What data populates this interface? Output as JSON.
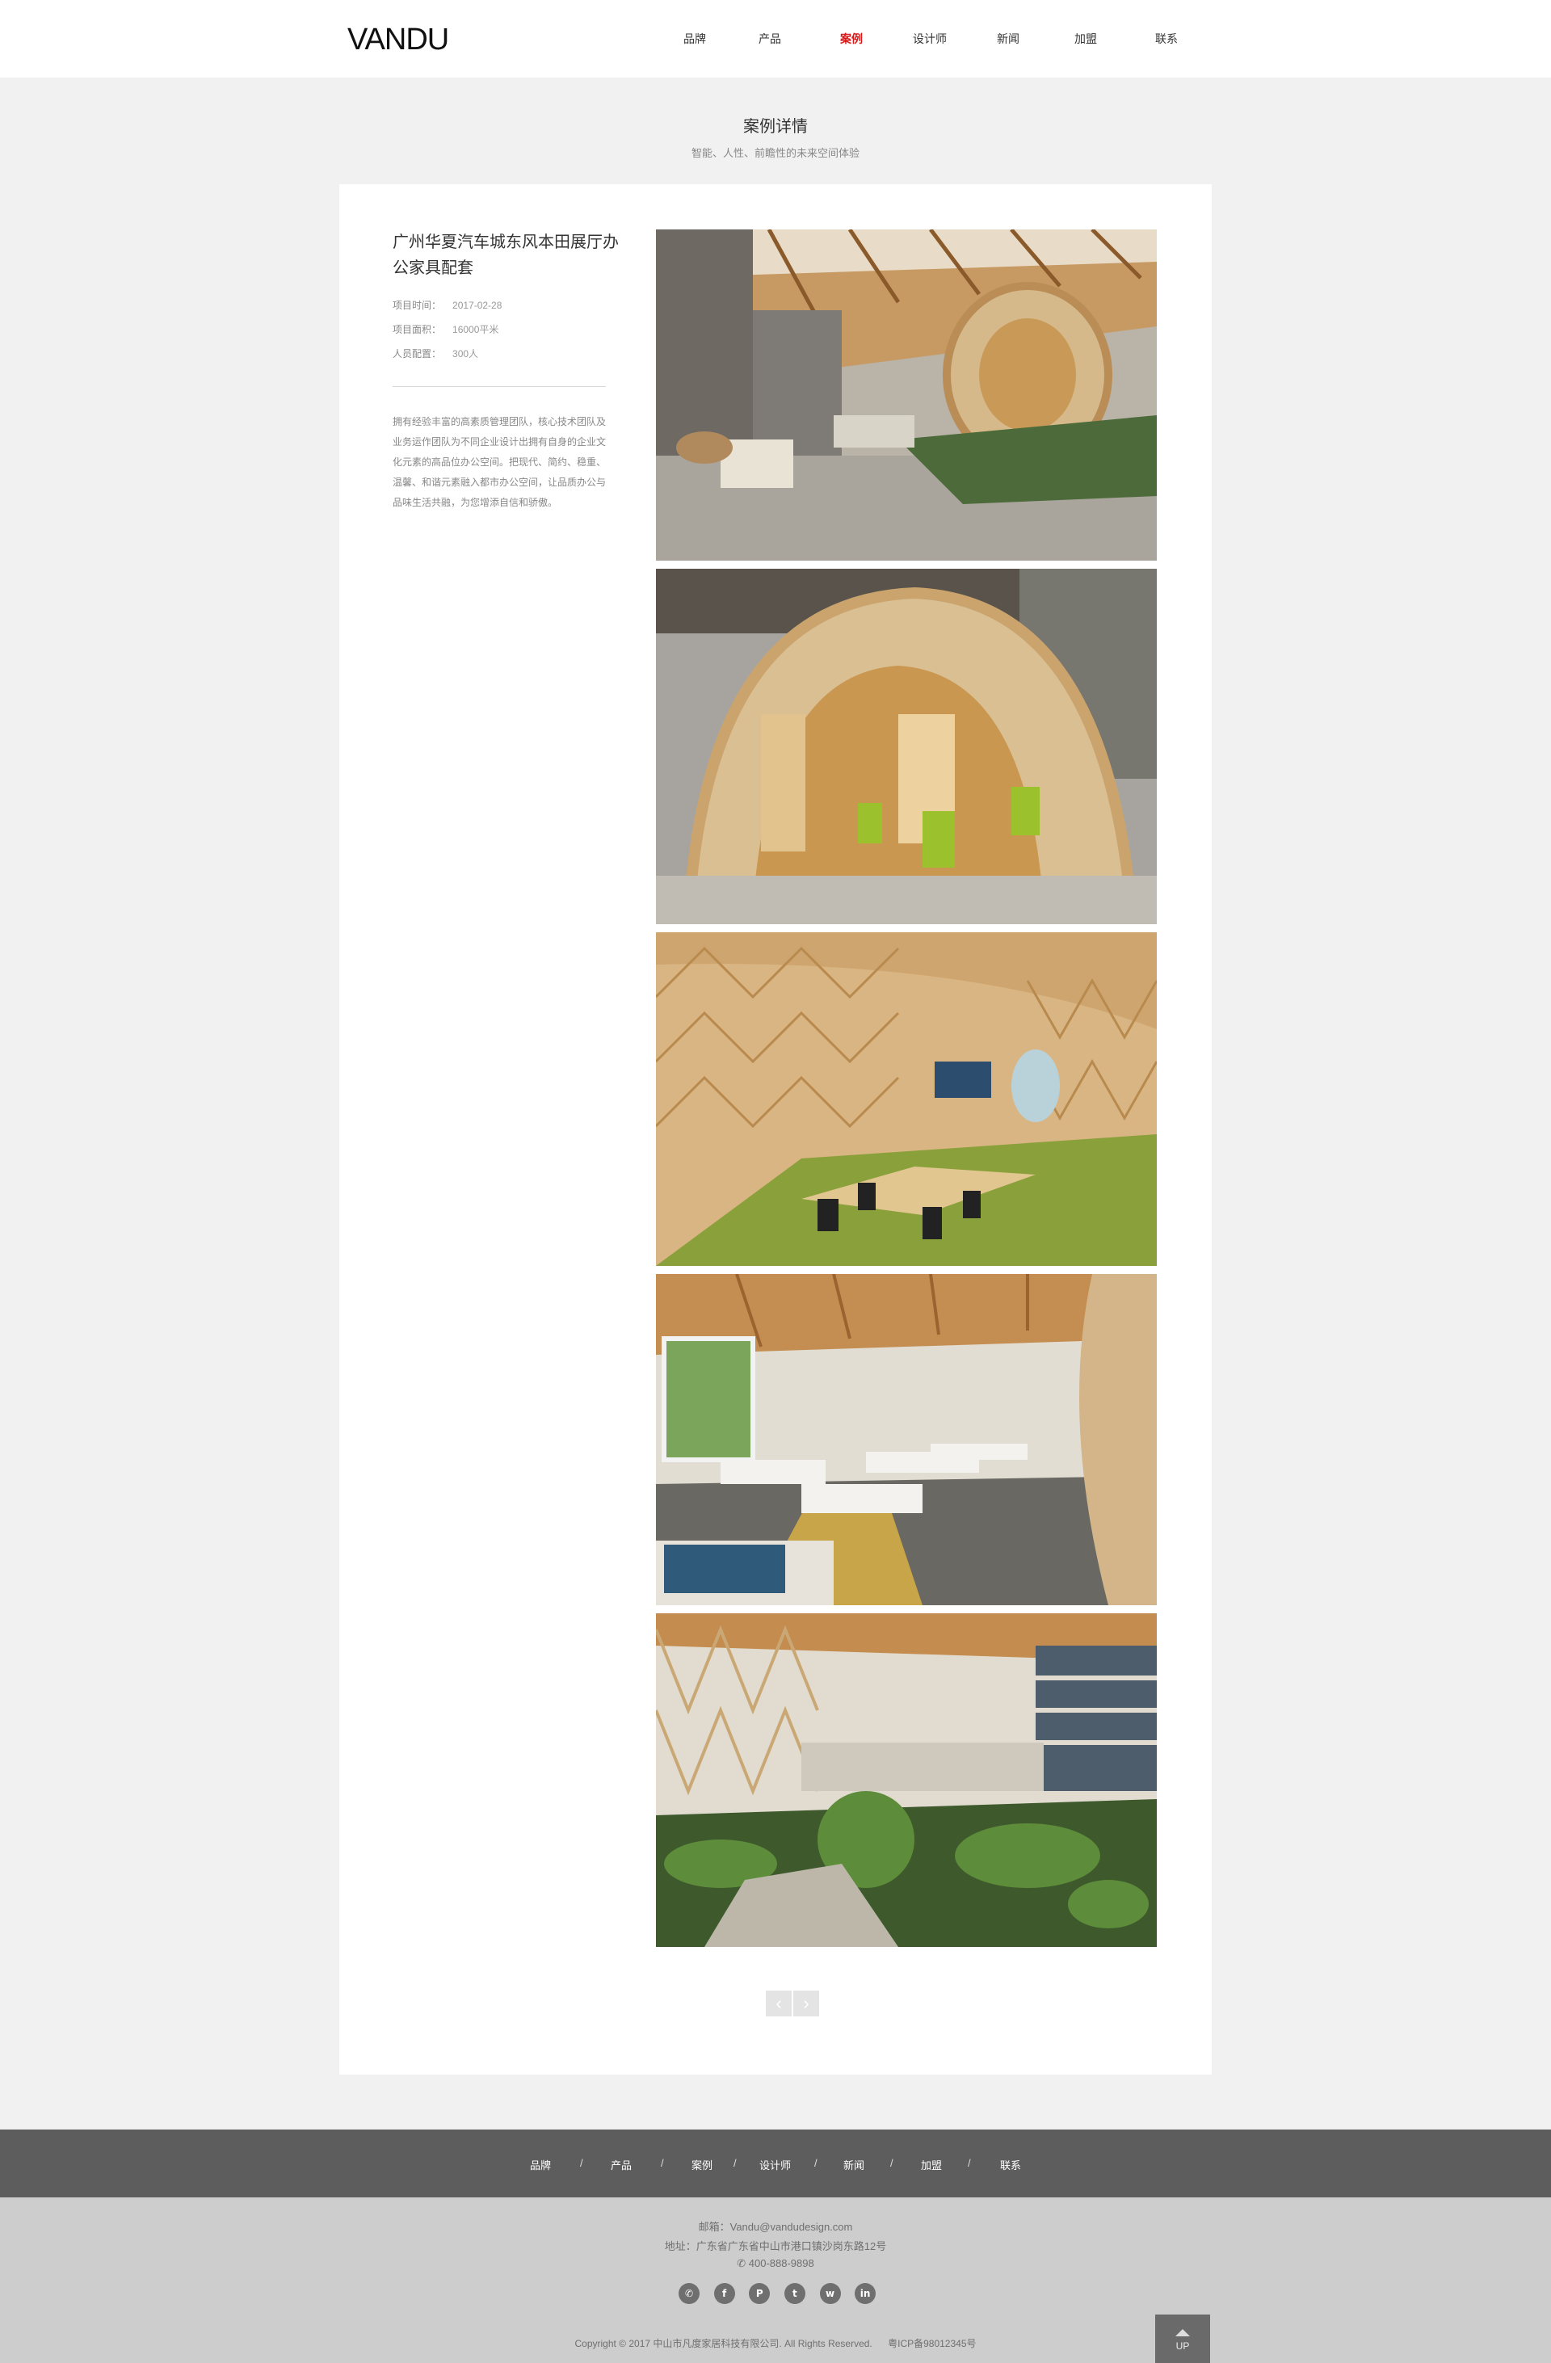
{
  "brand": {
    "logo": "VANDU"
  },
  "nav": {
    "items": [
      "品牌",
      "产品",
      "案例",
      "设计师",
      "新闻",
      "加盟",
      "联系"
    ],
    "active": "案例",
    "active_color": "#d71919"
  },
  "heading": {
    "title": "案例详情",
    "subtitle": "智能、人性、前瞻性的未来空间体验"
  },
  "project": {
    "title": "广州华夏汽车城东风本田展厅办公家具配套",
    "meta": [
      {
        "label": "项目时间：",
        "value": "2017-02-28"
      },
      {
        "label": "项目面积：",
        "value": "16000平米"
      },
      {
        "label": "人员配置：",
        "value": "300人"
      }
    ],
    "description": "拥有经验丰富的高素质管理团队，核心技术团队及业务运作团队为不同企业设计出拥有自身的企业文化元素的高品位办公空间。把现代、简约、稳重、温馨、和谐元素融入都市办公空间，让品质办公与品味生活共融，为您增添自信和骄傲。"
  },
  "gallery": {
    "photos": [
      "office-atrium-photo",
      "wooden-pod-lounge-photo",
      "wooden-meeting-room-photo",
      "open-workspace-photo",
      "indoor-garden-photo"
    ]
  },
  "pager": {
    "prev": "‹",
    "next": "›"
  },
  "footer_nav": {
    "items": [
      "品牌",
      "产品",
      "案例",
      "设计师",
      "新闻",
      "加盟",
      "联系"
    ],
    "separator": "/"
  },
  "footer": {
    "email": "邮箱：Vandu@vandudesign.com",
    "address": "地址：广东省广东省中山市港口镇沙岗东路12号",
    "phone": "400-888-9898",
    "social": [
      {
        "name": "wechat-icon",
        "glyph": "✆"
      },
      {
        "name": "facebook-icon",
        "glyph": "f"
      },
      {
        "name": "pinterest-icon",
        "glyph": "P"
      },
      {
        "name": "twitter-icon",
        "glyph": "t"
      },
      {
        "name": "weibo-icon",
        "glyph": "w"
      },
      {
        "name": "linkedin-icon",
        "glyph": "in"
      }
    ],
    "copyright": "Copyright © 2017 中山市凡度家居科技有限公司. All Rights Reserved.",
    "icp": "粤ICP备98012345号",
    "up_label": "UP"
  }
}
